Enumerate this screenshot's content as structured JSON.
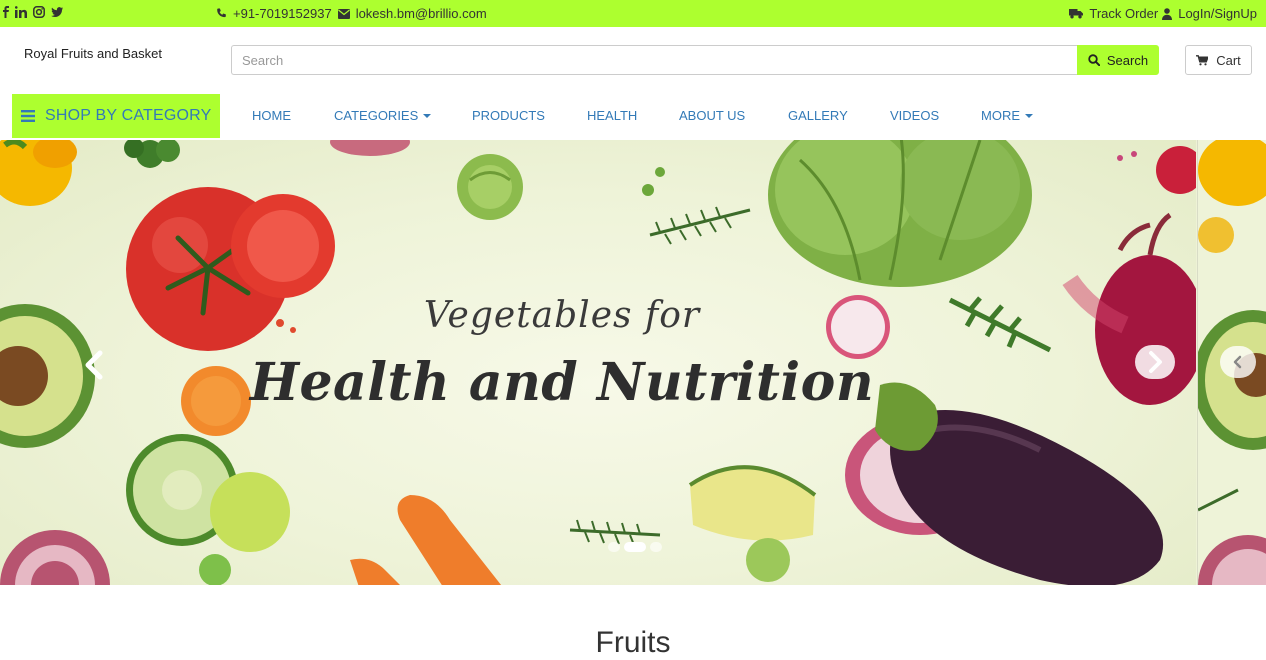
{
  "topbar": {
    "bg_color": "#adff2f",
    "social_icons": [
      "facebook-icon",
      "linkedin-icon",
      "instagram-icon",
      "twitter-icon"
    ],
    "phone": "+91-7019152937",
    "email": "lokesh.bm@brillio.com",
    "track_order": "Track Order",
    "login": "LogIn/SignUp"
  },
  "header": {
    "brand": "Royal Fruits and Basket",
    "search_placeholder": "Search",
    "search_button": "Search",
    "cart_label": "Cart"
  },
  "nav": {
    "shop_by_category": "SHOP BY CATEGORY",
    "items": [
      "HOME",
      "CATEGORIES",
      "PRODUCTS",
      "HEALTH",
      "ABOUT US",
      "GALLERY",
      "VIDEOS",
      "MORE"
    ],
    "link_color": "#337ab7"
  },
  "carousel": {
    "headline_line1": "Vegetables for",
    "headline_line2": "Health and Nutrition",
    "slide_count": 3,
    "active_slide": 2
  },
  "section": {
    "title": "Fruits"
  }
}
